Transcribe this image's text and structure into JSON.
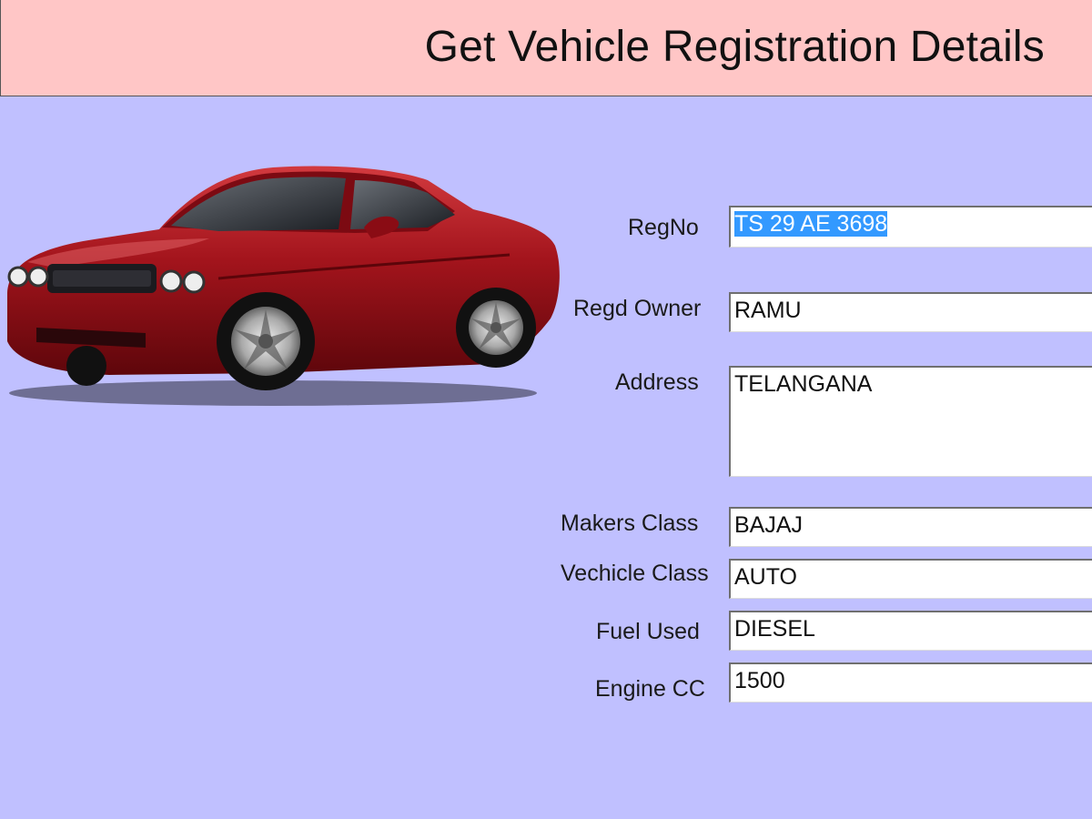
{
  "window": {
    "title": "Get Vehicle Registration Details"
  },
  "form": {
    "regno": {
      "label": "RegNo",
      "value": "TS 29 AE 3698"
    },
    "owner": {
      "label": "Regd Owner",
      "value": "RAMU"
    },
    "address": {
      "label": "Address",
      "value": "TELANGANA"
    },
    "makers_class": {
      "label": "Makers Class",
      "value": "BAJAJ"
    },
    "vehicle_class": {
      "label": "Vechicle Class",
      "value": "AUTO"
    },
    "fuel_used": {
      "label": "Fuel Used",
      "value": "DIESEL"
    },
    "engine_cc": {
      "label": "Engine CC",
      "value": "1500"
    }
  },
  "colors": {
    "header_bg": "#ffc6c6",
    "form_bg": "#c0c0ff",
    "selection": "#3399ff",
    "car_body": "#a3141c"
  },
  "image": {
    "subject": "red-sports-car"
  }
}
